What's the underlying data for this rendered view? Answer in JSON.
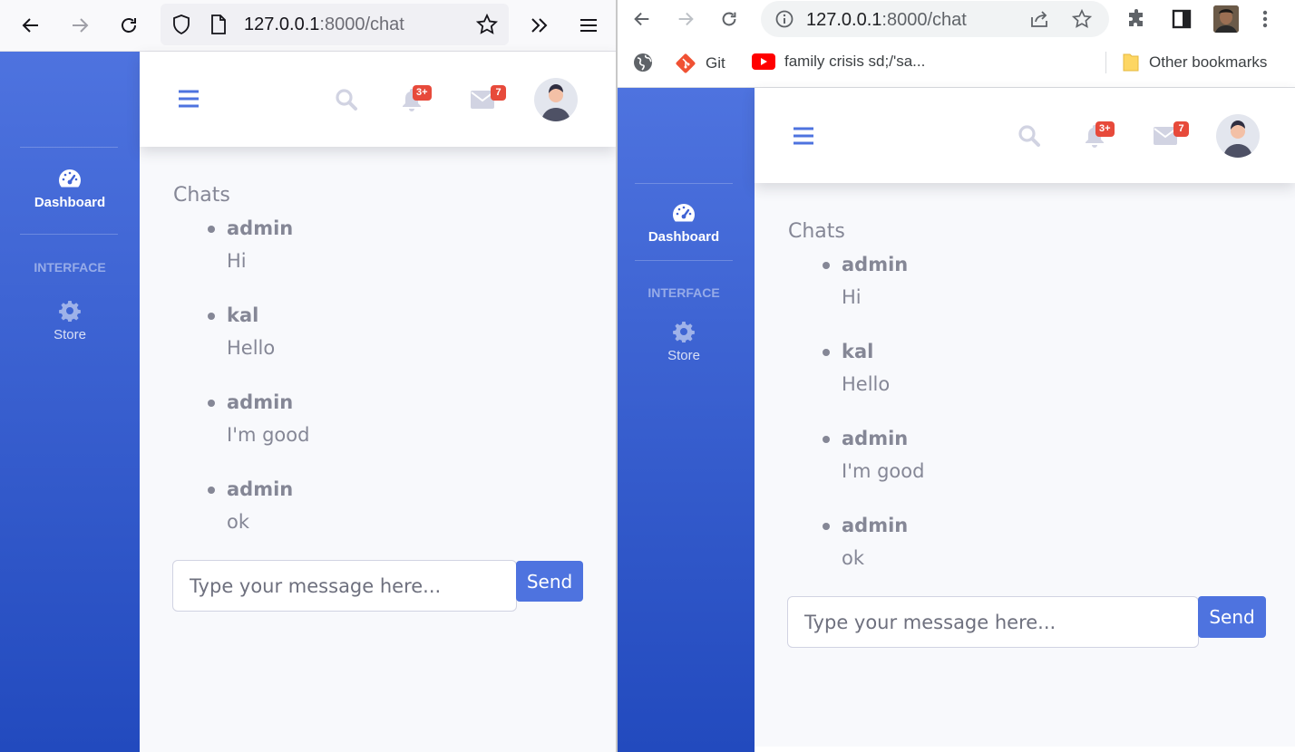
{
  "firefox": {
    "url_host": "127.0.0.1",
    "url_path": ":8000/chat"
  },
  "chrome": {
    "url_host": "127.0.0.1",
    "url_path": ":8000/chat",
    "bookmarks": [
      {
        "label": "Git"
      },
      {
        "label": "family crisis sd;/'sa..."
      }
    ],
    "other_bookmarks": "Other bookmarks"
  },
  "app": {
    "sidebar": {
      "dashboard": "Dashboard",
      "heading": "INTERFACE",
      "store": "Store"
    },
    "topbar": {
      "alerts_badge": "3+",
      "messages_badge": "7"
    },
    "chats_title": "Chats",
    "messages": [
      {
        "user": "admin",
        "text": "Hi"
      },
      {
        "user": "kal",
        "text": "Hello"
      },
      {
        "user": "admin",
        "text": "I'm good"
      },
      {
        "user": "admin",
        "text": "ok"
      }
    ],
    "input_placeholder": "Type your message here...",
    "send_label": "Send"
  },
  "colors": {
    "primary": "#4e73df",
    "sidebar_bottom": "#224abe",
    "badge": "#e74a3b",
    "text_muted": "#858796"
  }
}
